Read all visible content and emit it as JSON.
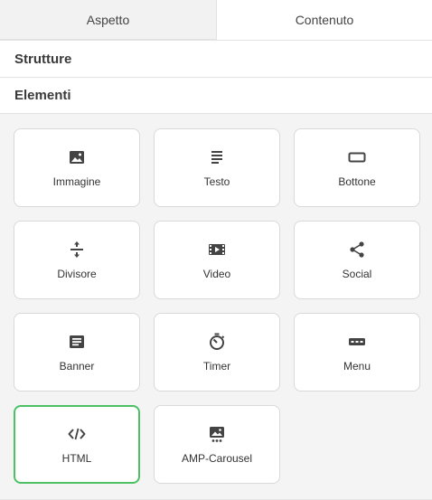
{
  "tabs": [
    {
      "label": "Aspetto",
      "active": false
    },
    {
      "label": "Contenuto",
      "active": true
    }
  ],
  "sections": {
    "structures": "Strutture",
    "elements": "Elementi"
  },
  "elements": [
    {
      "label": "Immagine",
      "icon": "image-icon"
    },
    {
      "label": "Testo",
      "icon": "text-icon"
    },
    {
      "label": "Bottone",
      "icon": "button-icon"
    },
    {
      "label": "Divisore",
      "icon": "divider-icon"
    },
    {
      "label": "Video",
      "icon": "video-icon"
    },
    {
      "label": "Social",
      "icon": "share-icon"
    },
    {
      "label": "Banner",
      "icon": "banner-icon"
    },
    {
      "label": "Timer",
      "icon": "timer-icon"
    },
    {
      "label": "Menu",
      "icon": "menu-icon"
    },
    {
      "label": "HTML",
      "icon": "code-icon",
      "selected": true
    },
    {
      "label": "AMP-Carousel",
      "icon": "carousel-icon"
    }
  ],
  "colors": {
    "selected_border": "#4cc164",
    "icon": "#444444",
    "background": "#f4f4f4"
  }
}
